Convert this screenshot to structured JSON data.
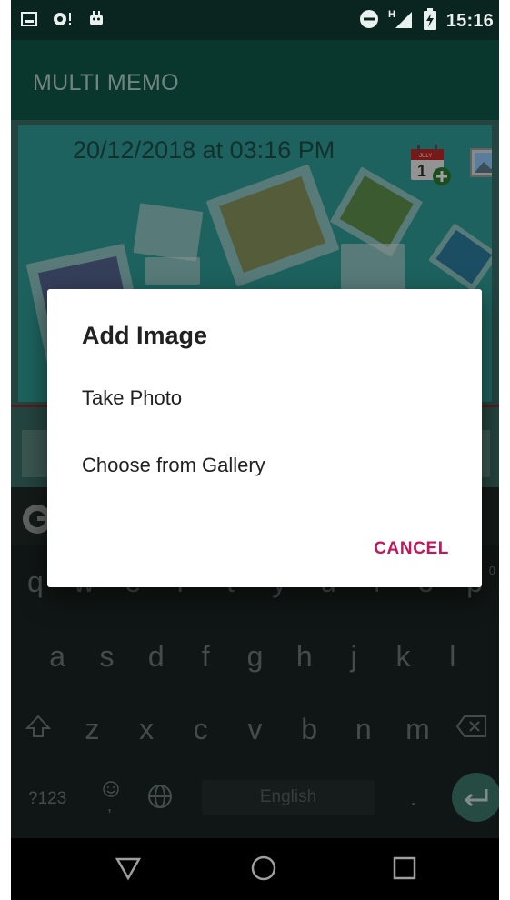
{
  "status_bar": {
    "time": "15:16",
    "network_label": "H",
    "left_icons": [
      "gallery-notification-icon",
      "sync-notification-icon",
      "android-debug-icon"
    ],
    "right_icons": [
      "do-not-disturb-icon",
      "signal-icon",
      "battery-charging-icon"
    ]
  },
  "app": {
    "title": "MULTI MEMO"
  },
  "memo": {
    "date_text": "20/12/2018 at 03:16 PM",
    "calendar_month": "JULY",
    "calendar_day": "1"
  },
  "dialog": {
    "title": "Add Image",
    "options": [
      "Take Photo",
      "Choose from Gallery"
    ],
    "cancel_label": "CANCEL"
  },
  "keyboard": {
    "row1": [
      "q",
      "w",
      "e",
      "r",
      "t",
      "y",
      "u",
      "i",
      "o",
      "p"
    ],
    "row2": [
      "a",
      "s",
      "d",
      "f",
      "g",
      "h",
      "j",
      "k",
      "l"
    ],
    "row3": [
      "z",
      "x",
      "c",
      "v",
      "b",
      "n",
      "m"
    ],
    "row1_hint": "0",
    "symbols_key": "?123",
    "emoji_key_sub": ",",
    "space_label": "English",
    "period_key": "."
  },
  "colors": {
    "accent_text": "#c2185b",
    "app_bar": "#0f5a4b",
    "memo_card": "#2f9e98"
  }
}
